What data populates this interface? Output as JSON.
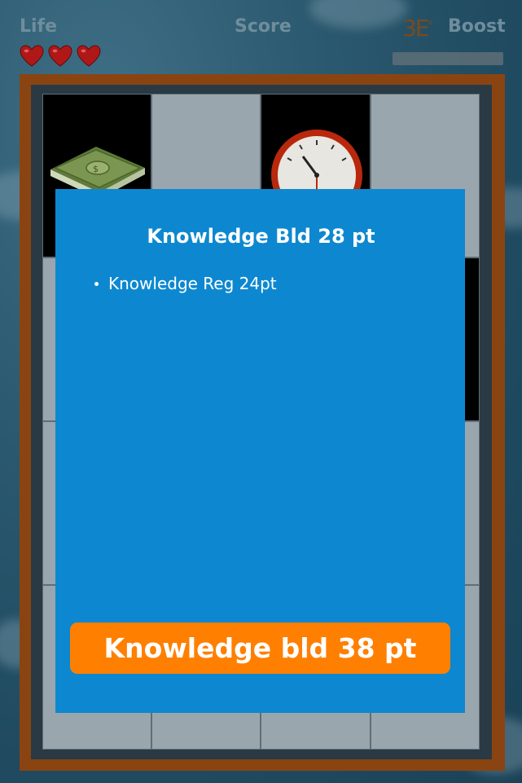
{
  "hud": {
    "life_label": "Life",
    "score_label": "Score",
    "boost_label": "Boost",
    "logo_text": "3E",
    "logo_mark": "*",
    "lives": 3,
    "heart_icon": "heart-icon",
    "heart_color": "#b01818"
  },
  "board": {
    "frame_color": "#8a4412",
    "rows": 4,
    "cols": 4,
    "visible_items": [
      "money-stack-icon",
      "clock-icon"
    ]
  },
  "modal": {
    "title": "Knowledge Bld 28 pt",
    "bullets": [
      "Knowledge Reg 24pt"
    ],
    "button_label": "Knowledge bld 38 pt",
    "background_color": "#0d88d0",
    "button_color": "#ff7f00"
  }
}
